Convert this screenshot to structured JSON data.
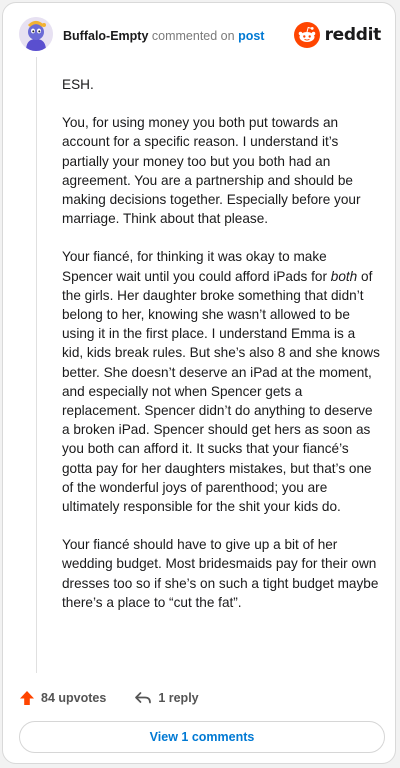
{
  "comment": {
    "author": "Buffalo-Empty",
    "action_text": "commented on",
    "target_text": "post",
    "brand": "reddit",
    "paragraphs": [
      "ESH.",
      "You, for using money you both put towards an account for a specific reason. I understand it’s partially your money too but you both had an agreement. You are a partnership and should be making decisions together. Especially before your marriage. Think about that please.",
      "Your fiancé, for thinking it was okay to make Spencer wait until you could afford iPads for both of the girls. Her daughter broke something that didn’t belong to her, knowing she wasn’t allowed to be using it in the first place. I understand Emma is a kid, kids break rules. But she’s also 8 and she knows better. She doesn’t deserve an iPad at the moment, and especially not when Spencer gets a replacement. Spencer didn’t do anything to deserve a broken iPad. Spencer should get hers as soon as you both can afford it. It sucks that your fiancé’s gotta pay for her daughters mistakes, but that’s one of the wonderful joys of parenthood; you are ultimately responsible for the shit your kids do.",
      "Your fiancé should have to give up a bit of her wedding budget. Most bridesmaids pay for their own dresses too so if she’s on such a tight budget maybe there’s a place to “cut the fat”."
    ]
  },
  "actions": {
    "upvotes": "84 upvotes",
    "replies": "1 reply"
  },
  "footer": {
    "view_comments": "View 1 comments"
  },
  "colors": {
    "upvote": "#ff4500",
    "link": "#0079d3",
    "brand_orange": "#ff4500"
  },
  "icons": {
    "avatar": "snoo-avatar",
    "brand": "reddit-logo-icon",
    "upvote": "upvote-arrow-icon",
    "reply": "reply-arrow-icon"
  }
}
